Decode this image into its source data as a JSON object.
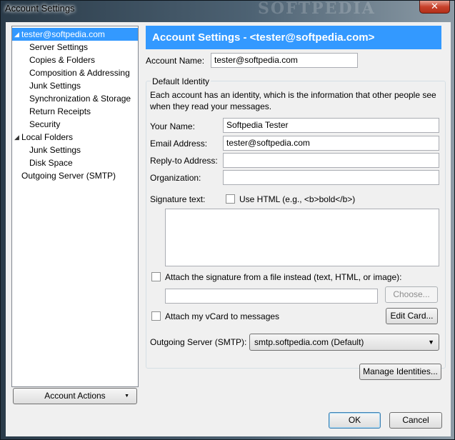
{
  "window": {
    "title": "Account Settings",
    "close_glyph": "✕",
    "watermark": "SOFTPEDIA"
  },
  "tree": [
    {
      "label": "tester@softpedia.com",
      "level": 0,
      "expanded": true,
      "selected": true
    },
    {
      "label": "Server Settings",
      "level": 1
    },
    {
      "label": "Copies & Folders",
      "level": 1
    },
    {
      "label": "Composition & Addressing",
      "level": 1
    },
    {
      "label": "Junk Settings",
      "level": 1
    },
    {
      "label": "Synchronization & Storage",
      "level": 1
    },
    {
      "label": "Return Receipts",
      "level": 1
    },
    {
      "label": "Security",
      "level": 1
    },
    {
      "label": "Local Folders",
      "level": 0,
      "expanded": true
    },
    {
      "label": "Junk Settings",
      "level": 1
    },
    {
      "label": "Disk Space",
      "level": 1
    },
    {
      "label": "Outgoing Server (SMTP)",
      "level": 0
    }
  ],
  "account_actions": {
    "label": "Account Actions",
    "arrow": "▼"
  },
  "header": {
    "title": "Account Settings - <tester@softpedia.com>",
    "color": "#3399ff"
  },
  "account_name": {
    "label": "Account Name:",
    "value": "tester@softpedia.com"
  },
  "identity": {
    "legend": "Default Identity",
    "description": "Each account has an identity, which is the information that other people see when they read your messages.",
    "your_name": {
      "label": "Your Name:",
      "value": "Softpedia Tester"
    },
    "email": {
      "label": "Email Address:",
      "value": "tester@softpedia.com"
    },
    "reply_to": {
      "label": "Reply-to Address:",
      "value": ""
    },
    "organization": {
      "label": "Organization:",
      "value": ""
    },
    "signature_label": "Signature text:",
    "use_html": {
      "label": "Use HTML (e.g., <b>bold</b>)",
      "checked": false
    },
    "signature_text": "",
    "attach_file": {
      "label": "Attach the signature from a file instead (text, HTML, or image):",
      "checked": false
    },
    "file_path": "",
    "choose_label": "Choose...",
    "attach_vcard": {
      "label": "Attach my vCard to messages",
      "checked": false
    },
    "edit_card_label": "Edit Card...",
    "outgoing": {
      "label": "Outgoing Server (SMTP):",
      "value": "smtp.softpedia.com (Default)"
    }
  },
  "manage_identities_label": "Manage Identities...",
  "ok_label": "OK",
  "cancel_label": "Cancel"
}
